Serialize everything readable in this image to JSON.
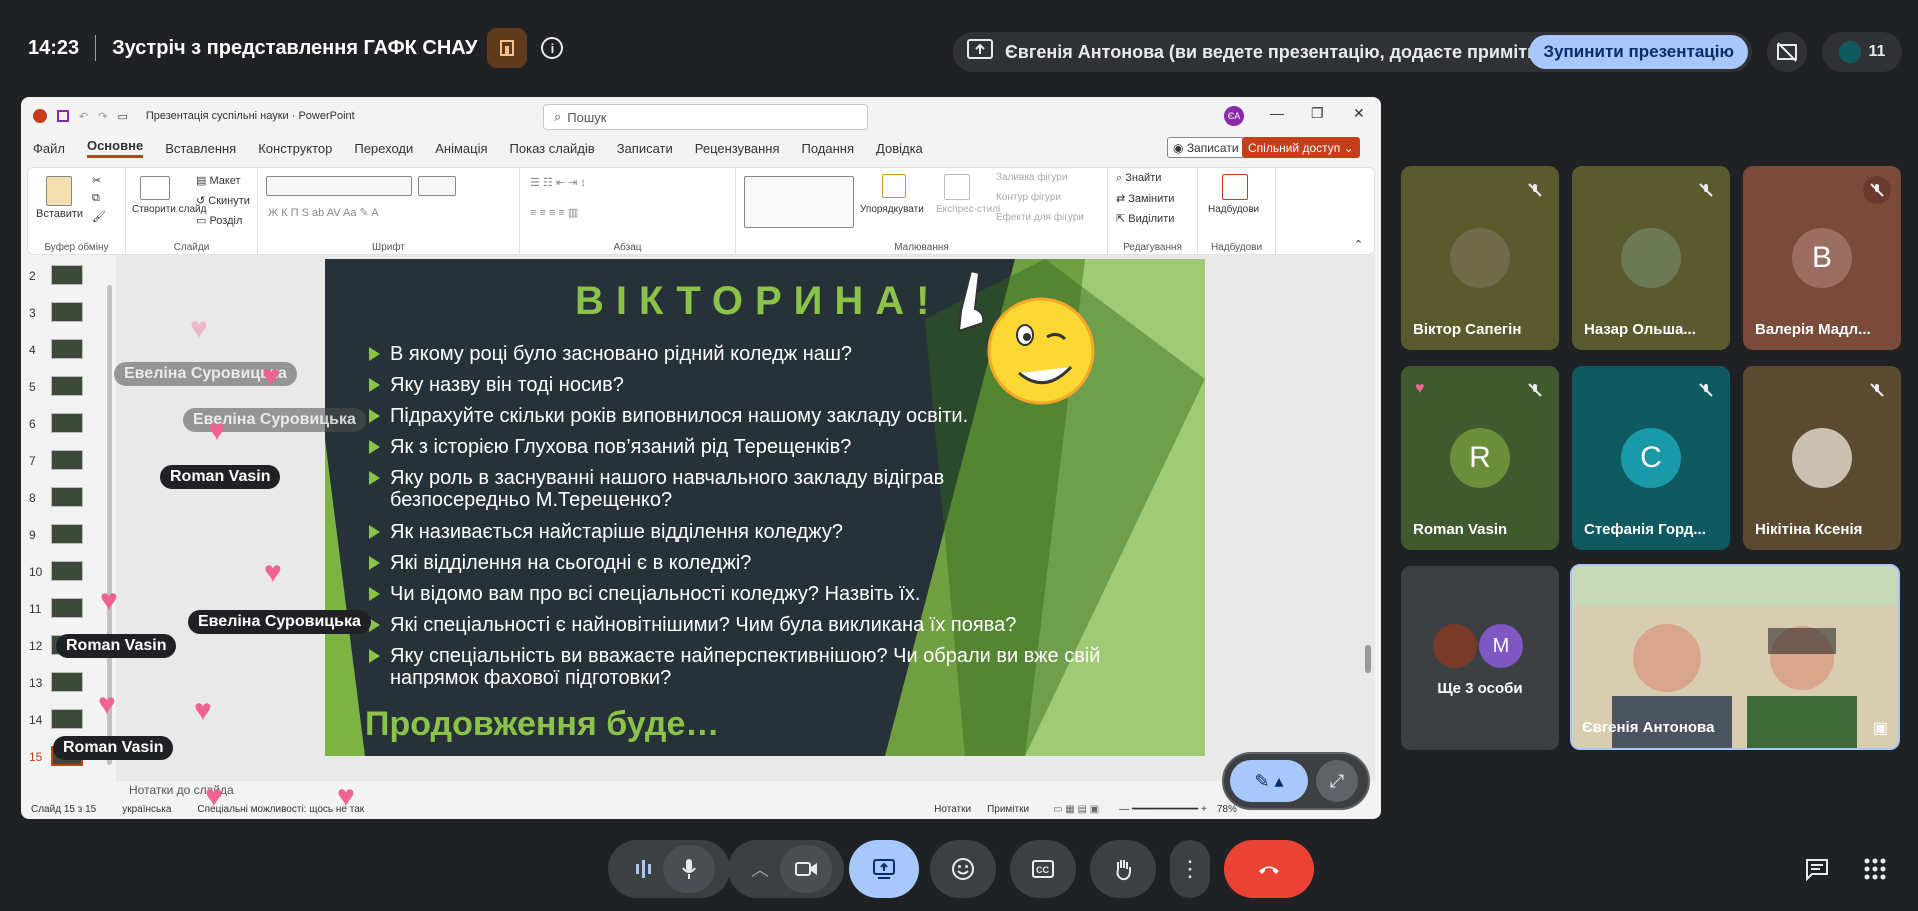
{
  "meeting": {
    "time": "14:23",
    "title": "Зустріч з представлення ГАФК СНАУ",
    "presenting_text": "Євгенія Антонова (ви ведете презентацію, додаєте примітки)",
    "stop_label": "Зупинити презентацію",
    "participant_count": "11"
  },
  "ppt": {
    "window_title": "Презентація суспільні науки  ·  PowerPoint",
    "search_placeholder": "Пошук",
    "user_initials": "ЄА",
    "menu": [
      "Файл",
      "Основне",
      "Вставлення",
      "Конструктор",
      "Переходи",
      "Анімація",
      "Показ слайдів",
      "Записати",
      "Рецензування",
      "Подання",
      "Довідка"
    ],
    "record_label": "Записати",
    "share_label": "Спільний доступ",
    "ribbon": {
      "paste": "Вставити",
      "clipboard": "Буфер обміну",
      "new_slide": "Створити слайд",
      "layout": "Макет",
      "reset": "Скинути",
      "section": "Розділ",
      "slides": "Слайди",
      "font": "Шрифт",
      "paragraph": "Абзац",
      "arrange": "Упорядкувати",
      "quick_styles": "Експрес-стилі",
      "shape_fill": "Заливка фігури",
      "shape_outline": "Контур фігури",
      "shape_effects": "Ефекти для фігури",
      "drawing": "Малювання",
      "find": "Знайти",
      "replace": "Замінити",
      "select": "Виділити",
      "editing": "Редагування",
      "addins": "Надбудови",
      "addins_group": "Надбудови"
    },
    "slide_numbers": [
      "2",
      "3",
      "4",
      "5",
      "6",
      "7",
      "8",
      "9",
      "10",
      "11",
      "12",
      "13",
      "14",
      "15"
    ],
    "notes_placeholder": "Нотатки до слайда",
    "status": {
      "slide": "Слайд 15 з 15",
      "language": "українська",
      "accessibility": "Спеціальні можливості: щось не так",
      "notes": "Нотатки",
      "comments": "Примітки",
      "zoom": "78%"
    }
  },
  "slide": {
    "title": "ВІКТОРИНА!",
    "questions": [
      "В якому році було засновано рідний коледж наш?",
      "Яку назву він тоді носив?",
      "Підрахуйте скільки років виповнилося нашому закладу освіти.",
      "Як з історією Глухова пов’язаний рід Терещенків?",
      "Яку роль в заснуванні нашого навчального закладу відіграв безпосередньо М.Терещенко?",
      "Як називається найстаріше відділення коледжу?",
      "Які відділення на сьогодні є в коледжі?",
      "Чи відомо вам про всі спеціальності коледжу? Назвіть їх.",
      "Які спеціальності є найновітнішими? Чим була викликана їх поява?",
      "Яку спеціальність ви вважаєте найперспективнішою? Чи обрали ви вже свій напрямок фахової підготовки?"
    ],
    "footer": "Продовження буде…"
  },
  "reactions": {
    "name_1": "Евеліна Суровицька",
    "name_2": "Roman Vasin"
  },
  "participants": [
    {
      "name": "Віктор Сапегін",
      "initial": "",
      "color": "#5a5a2e"
    },
    {
      "name": "Назар Ольша...",
      "initial": "",
      "color": "#5a5a2e"
    },
    {
      "name": "Валерія Мадл...",
      "initial": "В",
      "color": "#7a4a3a"
    },
    {
      "name": "Roman Vasin",
      "initial": "R",
      "color": "#3f5a2e"
    },
    {
      "name": "Стефанія Горд...",
      "initial": "С",
      "color": "#0f5a60"
    },
    {
      "name": "Нікітіна Ксенія",
      "initial": "",
      "color": "#5a4a30"
    }
  ],
  "others": {
    "label": "Ще 3 особи",
    "initial": "M"
  },
  "main_speaker": "Євгенія Антонова",
  "colors": {
    "accent": "#a8c7fa",
    "end_call": "#ea4335",
    "slide_green": "#8bc34a"
  }
}
